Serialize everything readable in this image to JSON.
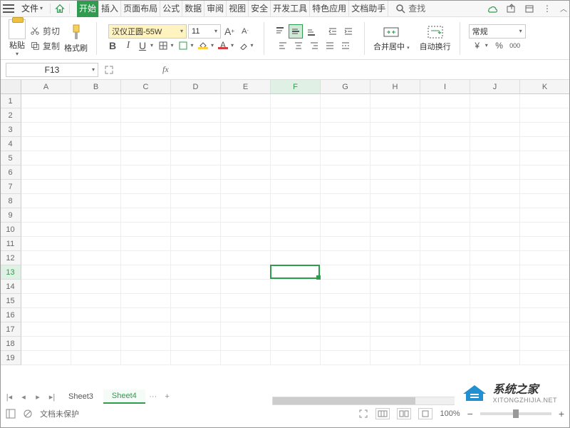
{
  "menu": {
    "file": "文件",
    "tabs": [
      "开始",
      "插入",
      "页面布局",
      "公式",
      "数据",
      "审阅",
      "视图",
      "安全",
      "开发工具",
      "特色应用",
      "文档助手"
    ],
    "active_tab_index": 0,
    "search": "查找"
  },
  "ribbon": {
    "paste": "粘贴",
    "cut": "剪切",
    "copy": "复制",
    "format_painter": "格式刷",
    "font_name": "汉仪正圆-55W",
    "font_size": "11",
    "merge_center": "合并居中",
    "auto_wrap": "自动换行",
    "general": "常规",
    "currency": "¥",
    "percent": "%",
    "decimals": "000"
  },
  "formulabar": {
    "cell_ref": "F13",
    "fx": "fx",
    "value": ""
  },
  "grid": {
    "columns": [
      "A",
      "B",
      "C",
      "D",
      "E",
      "F",
      "G",
      "H",
      "I",
      "J",
      "K"
    ],
    "rows": [
      "1",
      "2",
      "3",
      "4",
      "5",
      "6",
      "7",
      "8",
      "9",
      "10",
      "11",
      "12",
      "13",
      "14",
      "15",
      "16",
      "17",
      "18",
      "19"
    ],
    "selected_col": "F",
    "selected_row": "13"
  },
  "sheets": {
    "tabs": [
      "Sheet3",
      "Sheet4"
    ],
    "active_index": 1,
    "more": "···",
    "add": "+"
  },
  "status": {
    "protect": "文档未保护",
    "zoom": "100%",
    "zoom_minus": "−",
    "zoom_plus": "+"
  },
  "watermark": {
    "title": "系统之家",
    "url": "XITONGZHIJIA.NET"
  }
}
